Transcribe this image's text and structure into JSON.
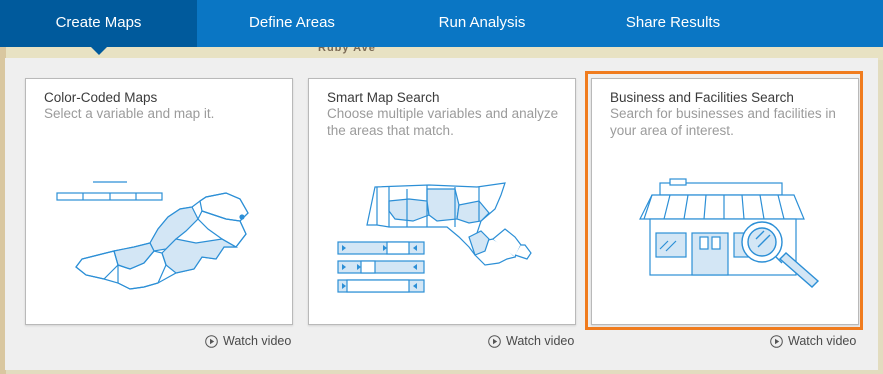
{
  "background_map": {
    "street_label": "Ruby Ave"
  },
  "nav": {
    "tabs": [
      {
        "label": "Create Maps",
        "active": true
      },
      {
        "label": "Define Areas",
        "active": false
      },
      {
        "label": "Run Analysis",
        "active": false
      },
      {
        "label": "Share Results",
        "active": false
      }
    ]
  },
  "cards": [
    {
      "title": "Color-Coded Maps",
      "description": "Select a variable and map it.",
      "icon": "choropleth-map-illustration",
      "watch_label": "Watch video",
      "selected": false
    },
    {
      "title": "Smart Map Search",
      "description": "Choose multiple variables and analyze the areas that match.",
      "icon": "slider-map-illustration",
      "watch_label": "Watch video",
      "selected": false
    },
    {
      "title": "Business and Facilities Search",
      "description": "Search for businesses and facilities in your area of interest.",
      "icon": "storefront-search-illustration",
      "watch_label": "Watch video",
      "selected": true
    }
  ],
  "colors": {
    "nav_bg": "#0a76c4",
    "nav_active": "#005a9c",
    "selection_border": "#f07c1e",
    "illustration_stroke": "#2c8fd6",
    "illustration_fill": "#d3e6f5"
  }
}
